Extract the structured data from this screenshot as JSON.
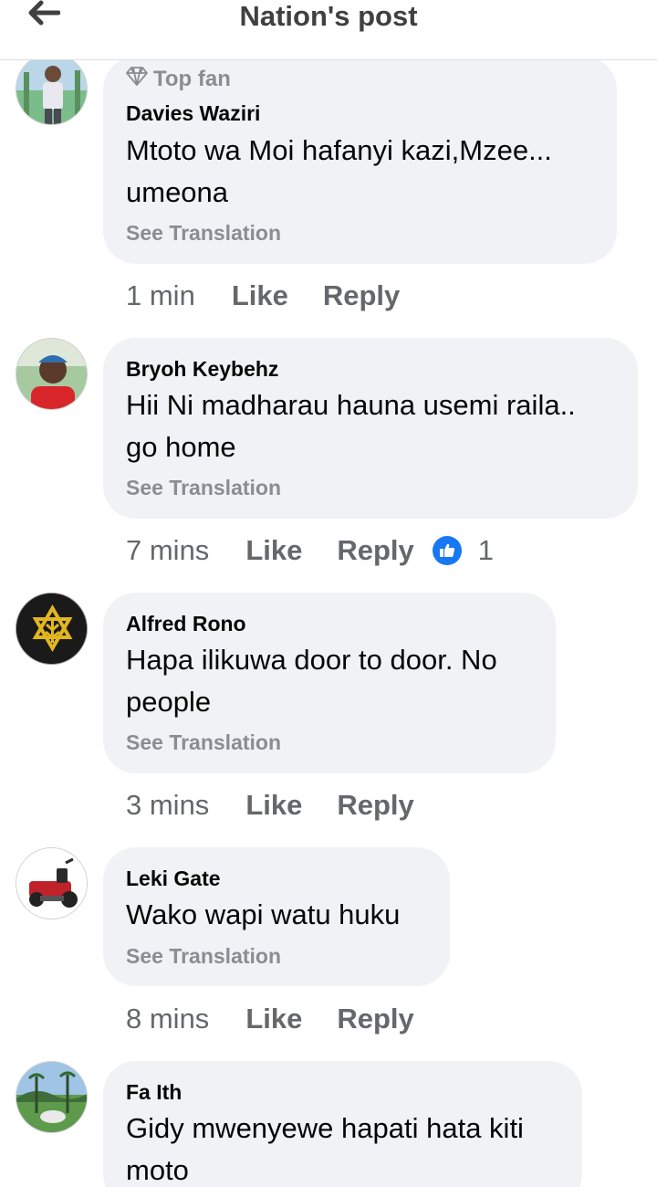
{
  "header": {
    "title": "Nation's post",
    "back_icon": "arrow-left-icon"
  },
  "colors": {
    "bubble": "#f0f2f5",
    "muted": "#65676b",
    "like_blue": "#1877f2"
  },
  "comments": [
    {
      "badge": "Top fan",
      "author": "Davies Waziri",
      "text": "Mtoto wa Moi hafanyi kazi,Mzee...\numeona",
      "see_translation": "See Translation",
      "time": "1 min",
      "like": "Like",
      "reply": "Reply",
      "reactions": null
    },
    {
      "author": "Bryoh Keybehz",
      "text": "Hii Ni madharau hauna usemi raila..\ngo home",
      "see_translation": "See Translation",
      "time": "7 mins",
      "like": "Like",
      "reply": "Reply",
      "reactions": "1"
    },
    {
      "author": "Alfred Rono",
      "text": "Hapa ilikuwa door to door. No\npeople",
      "see_translation": "See Translation",
      "time": "3 mins",
      "like": "Like",
      "reply": "Reply",
      "reactions": null
    },
    {
      "author": "Leki Gate",
      "text": "Wako wapi watu huku",
      "see_translation": "See Translation",
      "time": "8 mins",
      "like": "Like",
      "reply": "Reply",
      "reactions": null
    },
    {
      "author": "Fa Ith",
      "text": "Gidy mwenyewe hapati hata kiti\nmoto",
      "see_translation": null,
      "time": null,
      "like": null,
      "reply": null,
      "reactions": null
    }
  ]
}
